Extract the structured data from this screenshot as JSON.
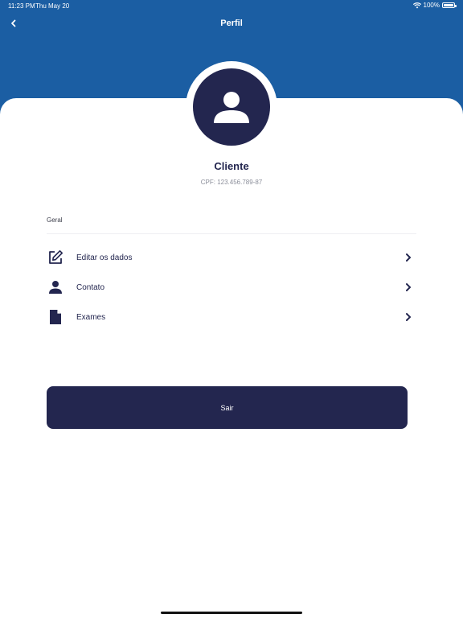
{
  "status_bar": {
    "time": "11:23 PM",
    "date": "Thu May 20",
    "battery": "100%"
  },
  "header": {
    "title": "Perfil",
    "back_icon": "chevron-left-icon"
  },
  "profile": {
    "avatar_icon": "user-icon",
    "name": "Cliente",
    "cpf": "CPF: 123.456.789-87"
  },
  "section": {
    "label": "Geral"
  },
  "menu": {
    "items": [
      {
        "label": "Editar os dados",
        "icon": "edit-icon"
      },
      {
        "label": "Contato",
        "icon": "person-icon"
      },
      {
        "label": "Exames",
        "icon": "document-icon"
      }
    ]
  },
  "logout": {
    "label": "Sair"
  },
  "colors": {
    "header": "#1b5ea3",
    "primary": "#23264f",
    "background": "#ffffff"
  }
}
